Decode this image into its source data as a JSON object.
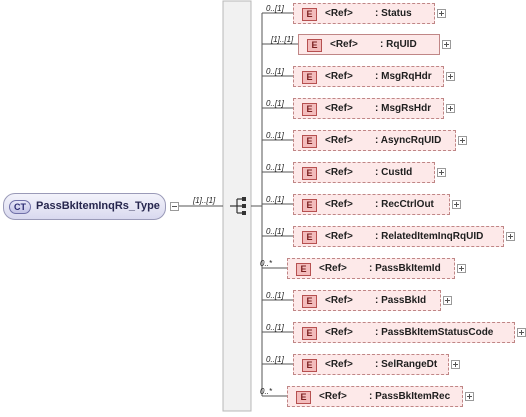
{
  "complex_type": {
    "badge": "CT",
    "name": "PassBkItemInqRs_Type"
  },
  "sequence": {
    "multiplicity": "[1]..[1]"
  },
  "element_badge": "E",
  "ref_keyword": "<Ref>",
  "elements": [
    {
      "multiplicity": "0..[1]",
      "name": ": Status"
    },
    {
      "multiplicity": "[1]..[1]",
      "name": ": RqUID"
    },
    {
      "multiplicity": "0..[1]",
      "name": ": MsgRqHdr"
    },
    {
      "multiplicity": "0..[1]",
      "name": ": MsgRsHdr"
    },
    {
      "multiplicity": "0..[1]",
      "name": ": AsyncRqUID"
    },
    {
      "multiplicity": "0..[1]",
      "name": ": CustId"
    },
    {
      "multiplicity": "0..[1]",
      "name": ": RecCtrlOut"
    },
    {
      "multiplicity": "0..[1]",
      "name": ": RelatedItemInqRqUID"
    },
    {
      "multiplicity": "0..*",
      "name": ": PassBkItemId"
    },
    {
      "multiplicity": "0..[1]",
      "name": ": PassBkId"
    },
    {
      "multiplicity": "0..[1]",
      "name": ": PassBkItemStatusCode"
    },
    {
      "multiplicity": "0..[1]",
      "name": ": SelRangeDt"
    },
    {
      "multiplicity": "0..*",
      "name": ": PassBkItemRec"
    }
  ],
  "colors": {
    "complex_type_fill": "#d9d9ef",
    "element_fill": "#fde9e9",
    "element_border": "#c08686",
    "element_badge": "#f3bcbc",
    "connector": "#555555"
  }
}
